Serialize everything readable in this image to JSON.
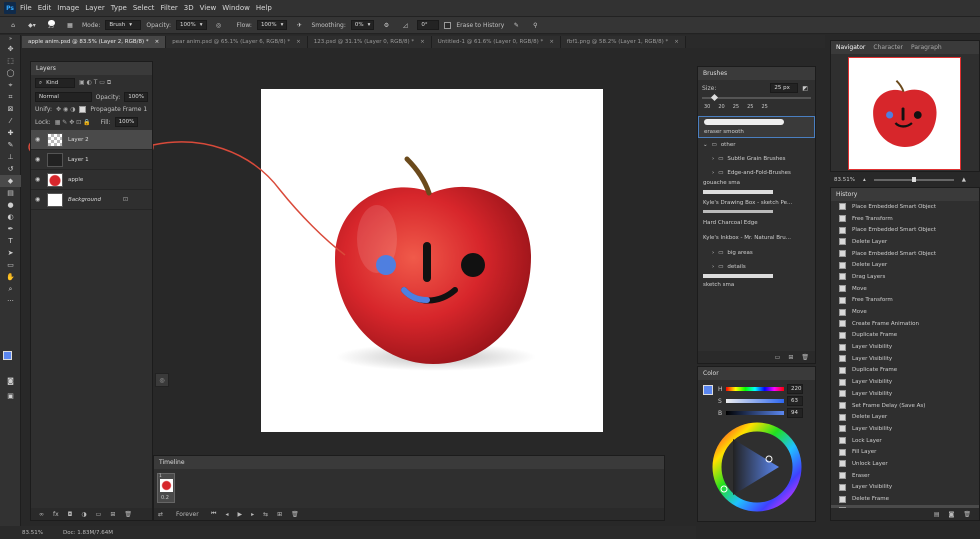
{
  "menu": {
    "logo": "Ps",
    "items": [
      "File",
      "Edit",
      "Image",
      "Layer",
      "Type",
      "Select",
      "Filter",
      "3D",
      "View",
      "Window",
      "Help"
    ]
  },
  "options": {
    "brush_size": "25",
    "mode_label": "Mode:",
    "mode": "Brush",
    "opacity_label": "Opacity:",
    "opacity": "100%",
    "flow_label": "Flow:",
    "flow": "100%",
    "smoothing_label": "Smoothing:",
    "smoothing": "0%",
    "angle": "0°",
    "erase_history": "Erase to History"
  },
  "tabs": [
    {
      "label": "apple anim.psd @ 83.5% (Layer 2, RGB/8) *"
    },
    {
      "label": "pear anim.psd @ 65.1% (Layer 6, RGB/8) *"
    },
    {
      "label": "123.psd @ 31.1% (Layer 0, RGB/8) *"
    },
    {
      "label": "Untitled-1 @ 61.6% (Layer 0, RGB/8) *"
    },
    {
      "label": "fbf1.png @ 58.2% (Layer 1, RGB/8) *"
    }
  ],
  "layers": {
    "title": "Layers",
    "kind": "Kind",
    "blend": "Normal",
    "opacity_label": "Opacity:",
    "opacity": "100%",
    "unify_label": "Unify:",
    "propagate": "Propagate Frame 1",
    "lock_label": "Lock:",
    "fill_label": "Fill:",
    "fill": "100%",
    "rows": [
      {
        "name": "Layer 2"
      },
      {
        "name": "Layer 1"
      },
      {
        "name": "apple"
      },
      {
        "name": "Background"
      }
    ]
  },
  "timeline": {
    "title": "Timeline",
    "frame_number": "1",
    "frame_delay": "0.2",
    "loop": "Forever"
  },
  "brushes": {
    "title": "Brushes",
    "size_label": "Size:",
    "size": "25 px",
    "presets": [
      "30",
      "20",
      "25",
      "25",
      "25"
    ],
    "items": [
      {
        "name": "eraser smooth",
        "type": "brush"
      },
      {
        "name": "other",
        "type": "folder"
      },
      {
        "name": "Subtle Grain Brushes",
        "type": "folder"
      },
      {
        "name": "Edge-and-Fold-Brushes",
        "type": "folder"
      },
      {
        "name": "gouache sma",
        "type": "brush"
      },
      {
        "name": "Kyle's Drawing Box - sketch Pe...",
        "type": "brush"
      },
      {
        "name": "Hard Charcoal Edge",
        "type": "brush"
      },
      {
        "name": "Kyle's Inkbox - Mr. Natural Bru...",
        "type": "brush"
      },
      {
        "name": "big areas",
        "type": "folder"
      },
      {
        "name": "details",
        "type": "folder"
      },
      {
        "name": "sketch sma",
        "type": "brush"
      }
    ]
  },
  "color": {
    "title": "Color",
    "h_label": "H",
    "s_label": "S",
    "b_label": "B",
    "h": "220",
    "s": "63",
    "b": "94",
    "swatch": "#5b87f0"
  },
  "navigator": {
    "tabs": [
      "Navigator",
      "Character",
      "Paragraph"
    ],
    "zoom": "83.51%"
  },
  "history": {
    "title": "History",
    "items": [
      "Place Embedded Smart Object",
      "Free Transform",
      "Place Embedded Smart Object",
      "Delete Layer",
      "Place Embedded Smart Object",
      "Delete Layer",
      "Drag Layers",
      "Move",
      "Free Transform",
      "Move",
      "Create Frame Animation",
      "Duplicate Frame",
      "Layer Visibility",
      "Layer Visibility",
      "Duplicate Frame",
      "Layer Visibility",
      "Layer Visibility",
      "Set Frame Delay (Save As)",
      "Delete Layer",
      "Layer Visibility",
      "Lock Layer",
      "Fill Layer",
      "Unlock Layer",
      "Eraser",
      "Layer Visibility",
      "Delete Frame",
      "Delete Frame"
    ]
  },
  "status": {
    "zoom": "83.51%",
    "doc": "Doc: 1.83M/7.64M"
  }
}
